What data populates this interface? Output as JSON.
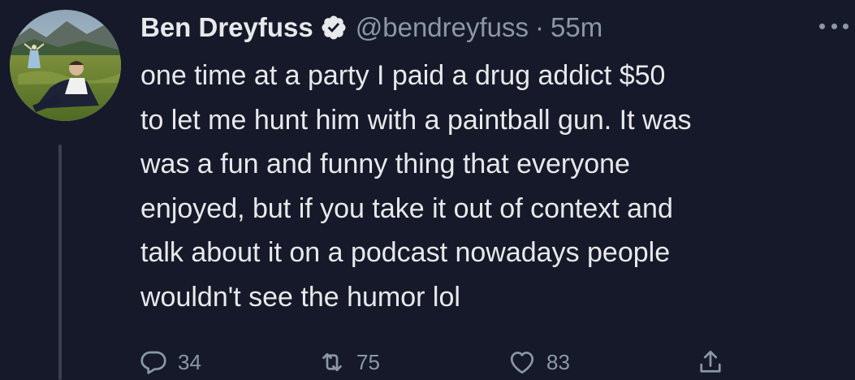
{
  "tweet": {
    "author": {
      "name": "Ben Dreyfuss",
      "handle": "@bendreyfuss",
      "verified": true,
      "avatar": "avatar-photo-field-mountains"
    },
    "separator": "·",
    "time": "55m",
    "text_lines": [
      "one time at a party I paid a drug addict $50",
      "to let me hunt him with a paintball gun. It was",
      "was a fun and funny thing that everyone",
      "enjoyed, but if you take it out of context and",
      "talk about it on a podcast nowadays people",
      "wouldn't see the humor lol"
    ],
    "actions": {
      "replies": "34",
      "retweets": "75",
      "likes": "83"
    },
    "icons": {
      "verified": "verified-badge-icon",
      "more": "more-horizontal-icon",
      "reply": "reply-bubble-icon",
      "retweet": "retweet-icon",
      "like": "heart-icon",
      "share": "share-upload-icon"
    }
  },
  "colors": {
    "background": "#16192a",
    "primary_text": "#e7e9ea",
    "secondary_text": "#8b98a5",
    "thread_line": "#3a3f4d"
  }
}
